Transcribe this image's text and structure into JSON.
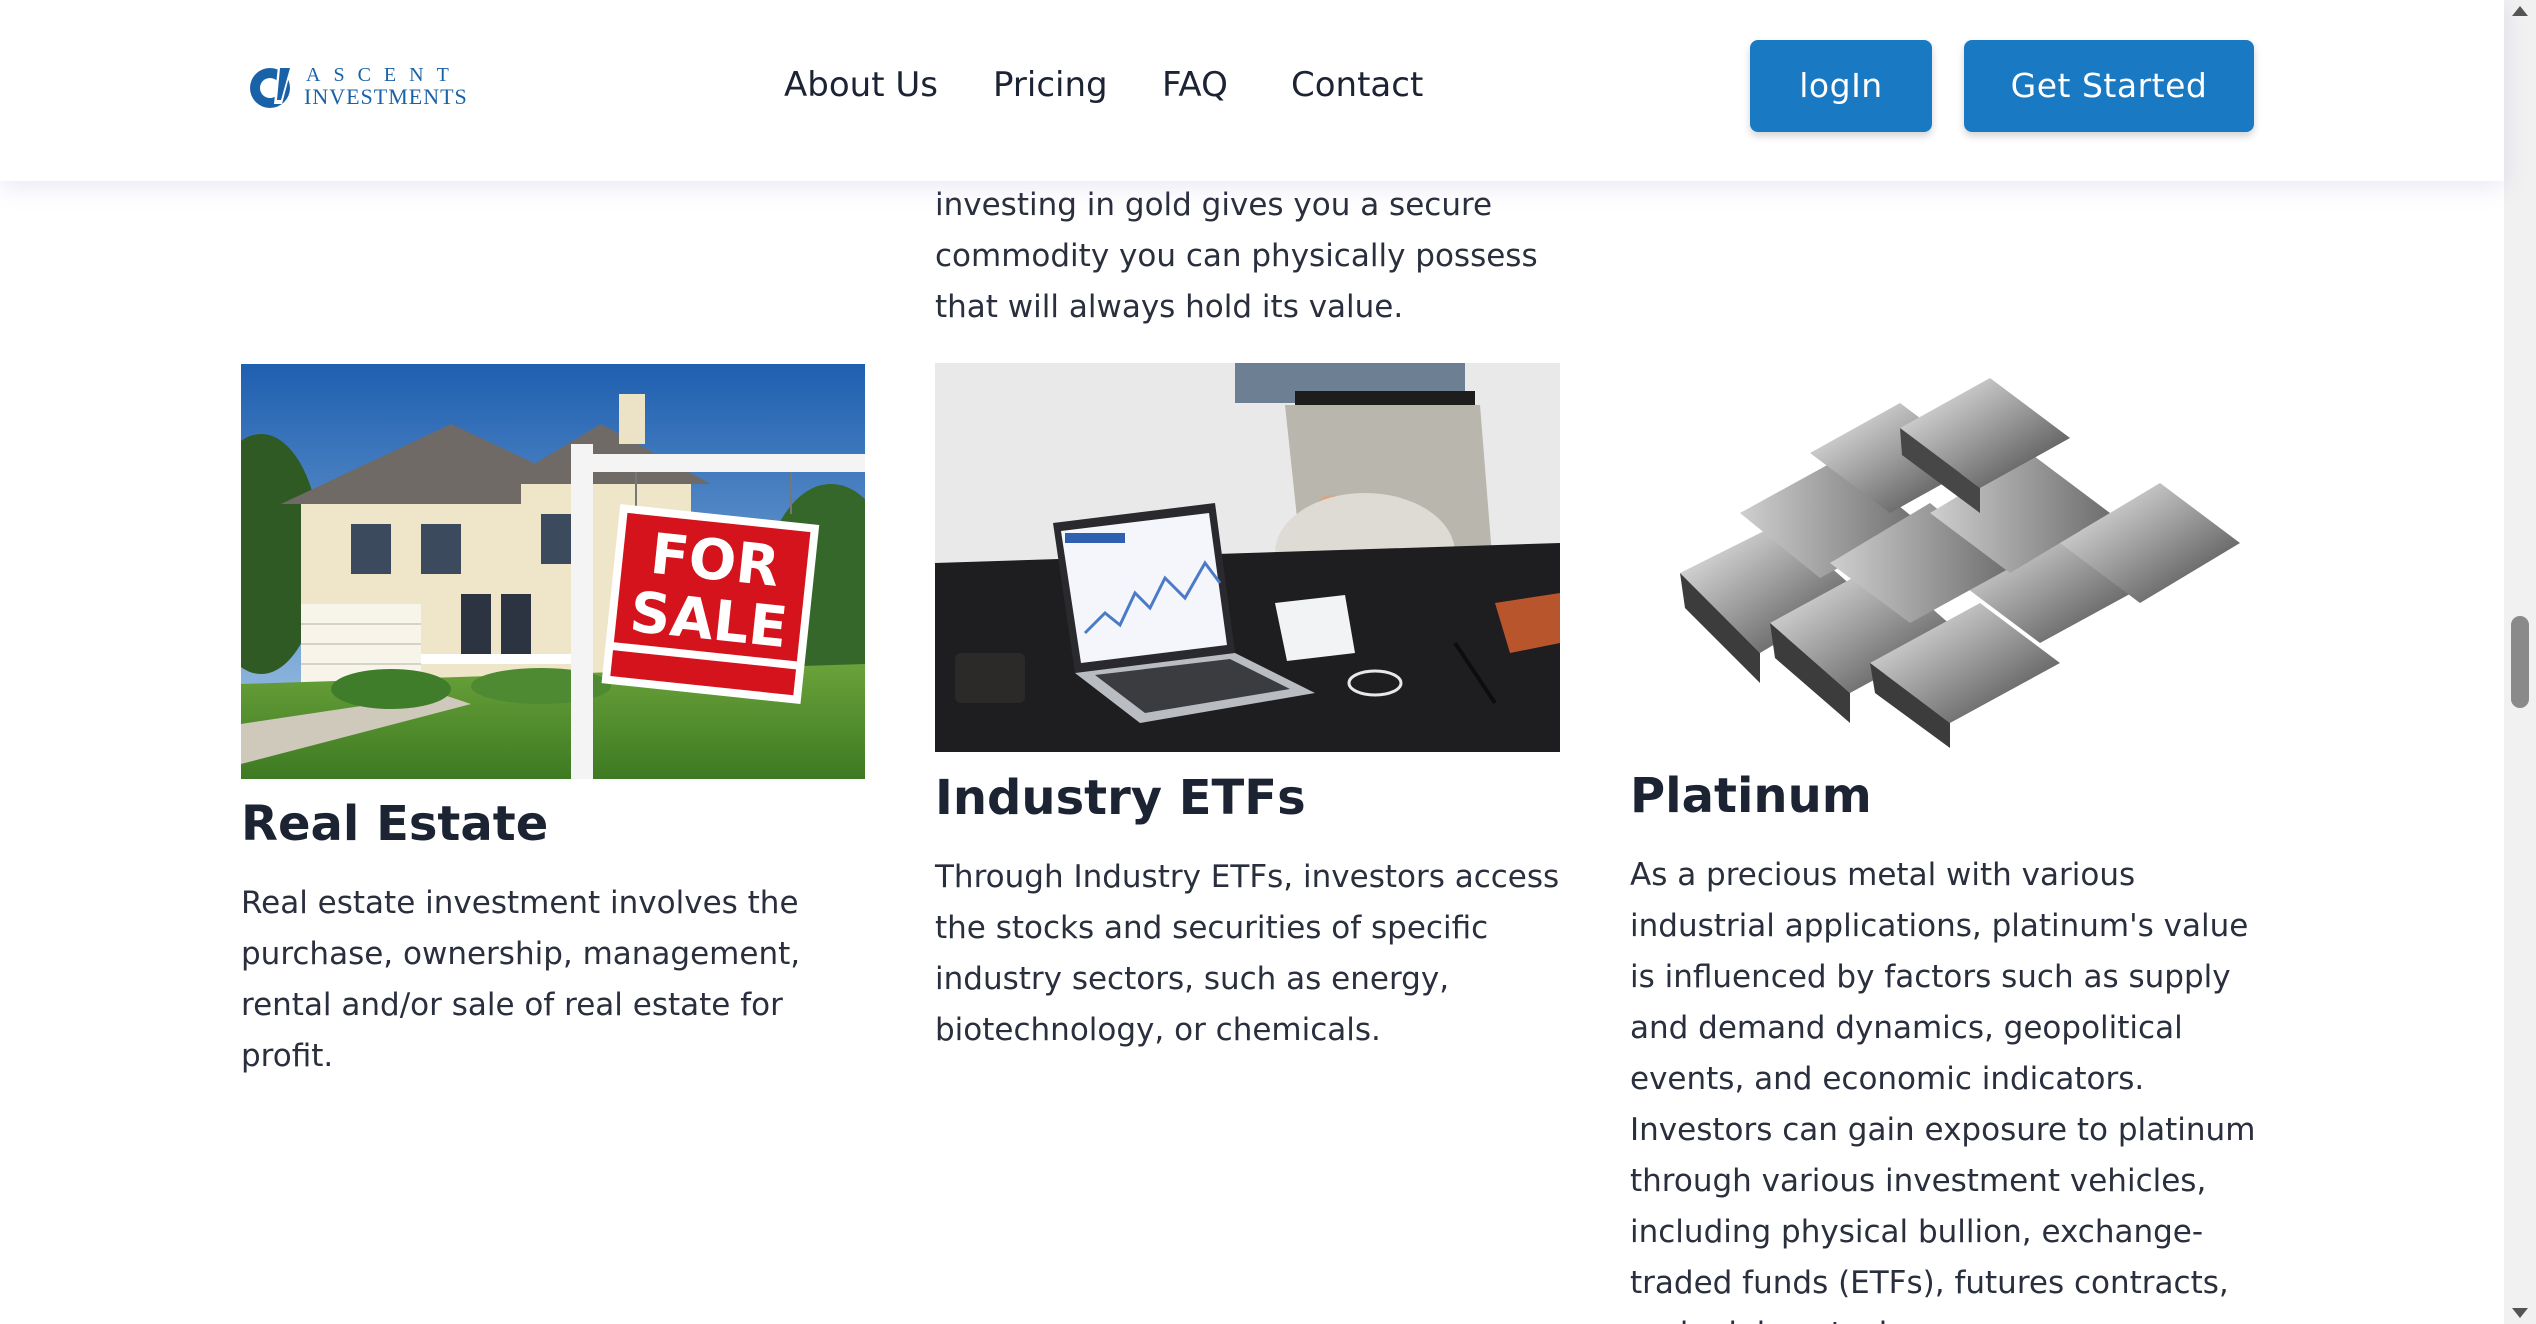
{
  "brand": {
    "logo_line1": "ASCENT",
    "logo_line2": "INVESTMENTS"
  },
  "nav": {
    "items": [
      "About Us",
      "Pricing",
      "FAQ",
      "Contact"
    ]
  },
  "header_buttons": {
    "login": "logIn",
    "get_started": "Get Started"
  },
  "gold": {
    "description_tail": "investing in gold gives you a secure commodity you can physically possess that will always hold its value."
  },
  "cards": [
    {
      "title": "Real Estate",
      "description": "Real estate investment involves the purchase, ownership, management, rental and/or sale of real estate for profit.",
      "image_icon": "for-sale-house-photo",
      "sign_text_1": "FOR",
      "sign_text_2": "SALE"
    },
    {
      "title": "Industry ETFs",
      "description": "Through Industry ETFs, investors access the stocks and securities of specific industry sectors, such as energy, biotechnology, or chemicals.",
      "image_icon": "laptop-stock-chart-photo"
    },
    {
      "title": "Platinum",
      "description": "As a precious metal with various industrial applications, platinum's value is influenced by factors such as supply and demand dynamics, geopolitical events, and economic indicators. Investors can gain exposure to platinum through various investment vehicles, including physical bullion, exchange-traded funds (ETFs), futures contracts, and mining stocks.",
      "image_icon": "platinum-bars-photo"
    }
  ],
  "colors": {
    "accent": "#1979c3",
    "text": "#1c2333",
    "logo": "#1a62a8"
  }
}
